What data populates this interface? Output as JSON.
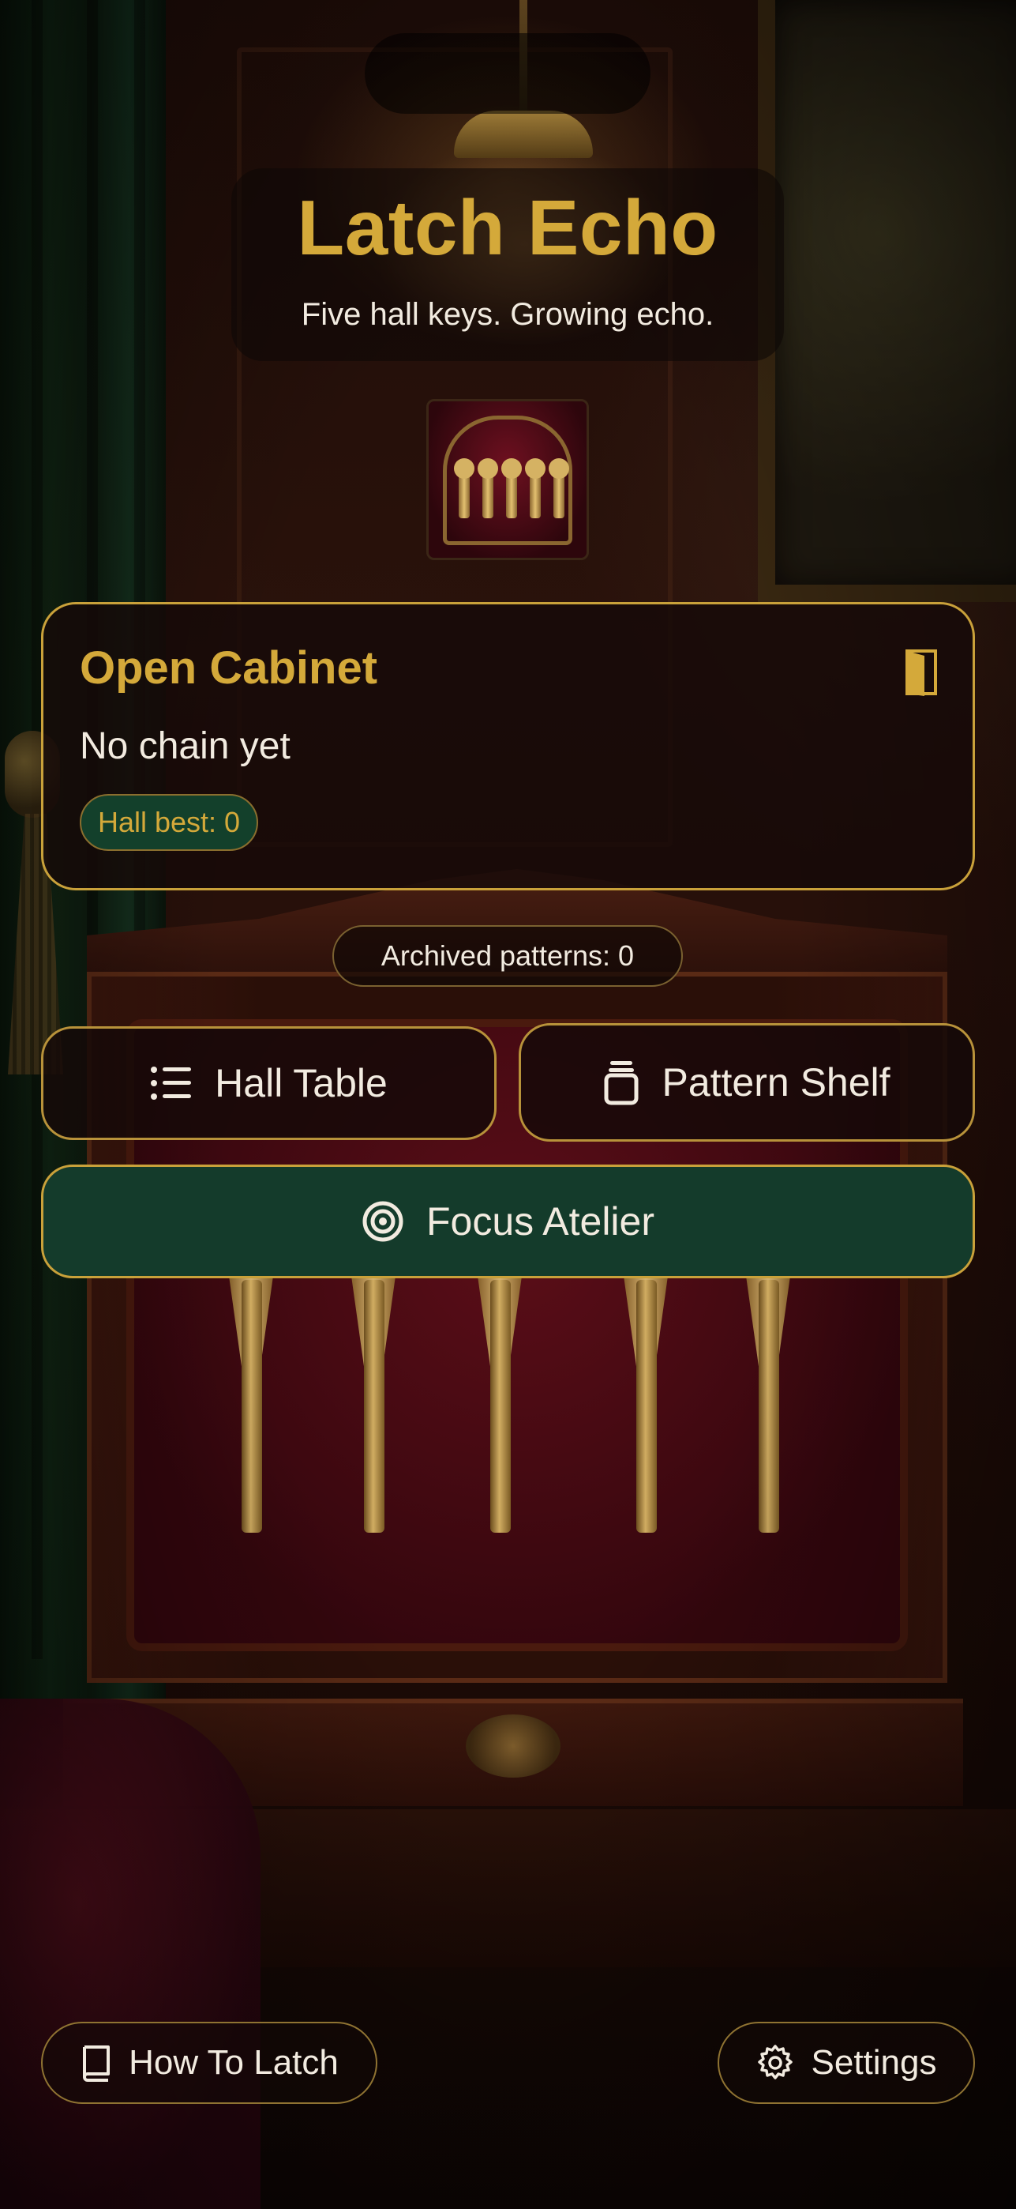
{
  "app": {
    "title": "Latch Echo",
    "subtitle": "Five hall keys. Growing echo."
  },
  "cabinet_card": {
    "title": "Open Cabinet",
    "status": "No chain yet",
    "best_label": "Hall best: 0",
    "icon": "door-icon"
  },
  "archived": {
    "label": "Archived patterns: 0"
  },
  "nav": {
    "hall_table": {
      "label": "Hall Table",
      "icon": "list-icon"
    },
    "pattern_shelf": {
      "label": "Pattern Shelf",
      "icon": "jar-icon"
    },
    "focus_atelier": {
      "label": "Focus Atelier",
      "icon": "target-icon"
    }
  },
  "footer": {
    "how_to": {
      "label": "How To Latch",
      "icon": "book-icon"
    },
    "settings": {
      "label": "Settings",
      "icon": "gear-icon"
    }
  },
  "colors": {
    "accent_gold": "#d4a93a",
    "text_light": "#f2ebe0",
    "focus_green": "#143b2b",
    "pill_green": "#13402b",
    "card_bg": "#160a08"
  }
}
